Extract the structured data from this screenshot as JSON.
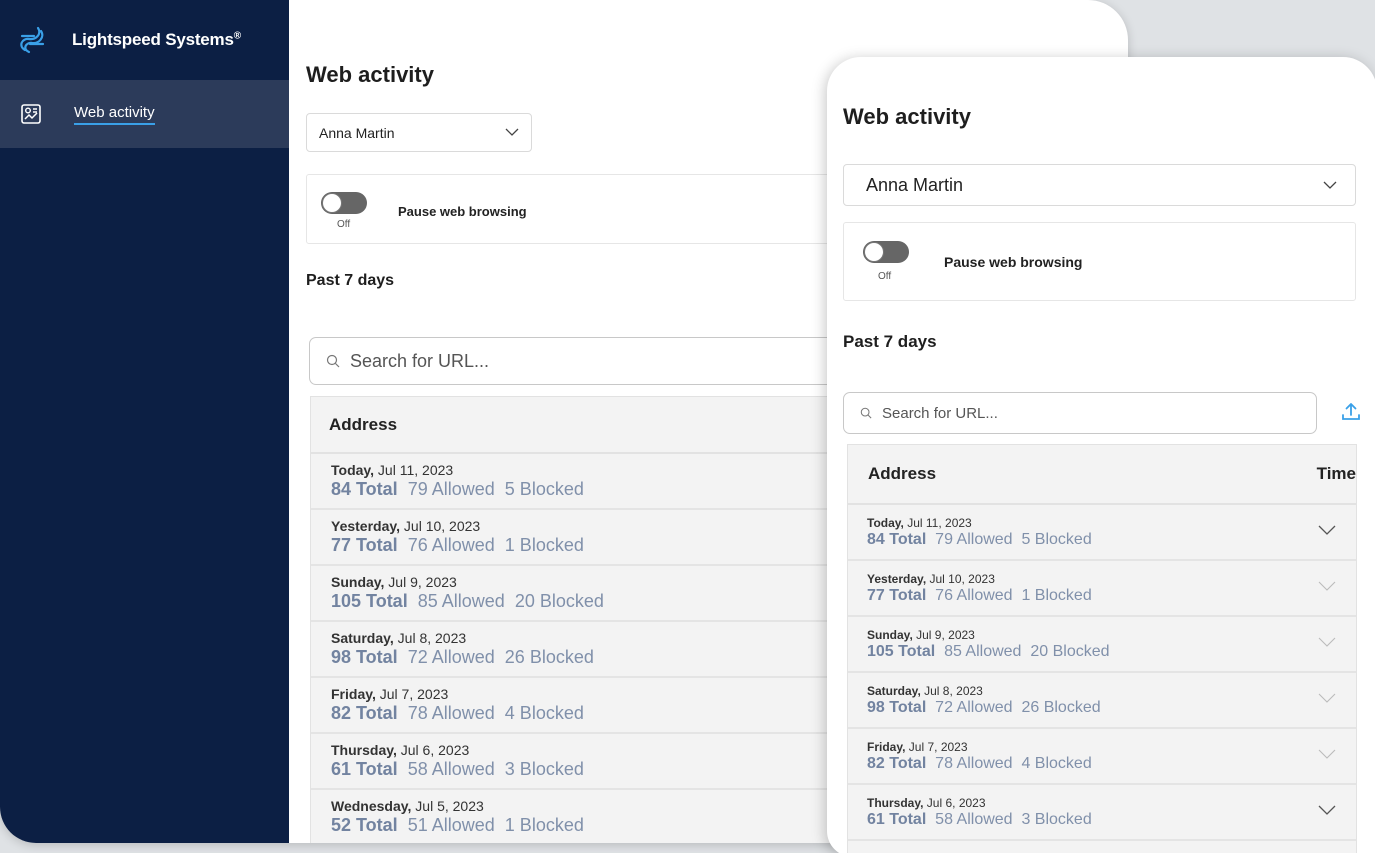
{
  "app": {
    "brand": "Lightspeed Systems",
    "brand_mark": "®"
  },
  "sidebar": {
    "items": [
      {
        "label": "Web activity",
        "icon": "activity-chart-icon"
      }
    ]
  },
  "page": {
    "title": "Web activity",
    "student_select": "Anna Martin",
    "pause": {
      "label": "Pause web browsing",
      "state": "Off"
    },
    "period": "Past 7 days",
    "search_placeholder": "Search for URL...",
    "table": {
      "columns": [
        "Address",
        "Time"
      ],
      "rows": [
        {
          "day": "Today,",
          "date": " Jul 11, 2023",
          "total": "84 Total",
          "allowed": "79 Allowed",
          "blocked": "5 Blocked"
        },
        {
          "day": "Yesterday,",
          "date": " Jul 10, 2023",
          "total": "77 Total",
          "allowed": "76 Allowed",
          "blocked": "1 Blocked"
        },
        {
          "day": "Sunday,",
          "date": " Jul 9, 2023",
          "total": "105 Total",
          "allowed": "85 Allowed",
          "blocked": "20 Blocked"
        },
        {
          "day": "Saturday,",
          "date": " Jul 8, 2023",
          "total": "98 Total",
          "allowed": "72 Allowed",
          "blocked": "26 Blocked"
        },
        {
          "day": "Friday,",
          "date": " Jul 7, 2023",
          "total": "82 Total",
          "allowed": "78 Allowed",
          "blocked": "4 Blocked"
        },
        {
          "day": "Thursday,",
          "date": " Jul 6, 2023",
          "total": "61 Total",
          "allowed": "58 Allowed",
          "blocked": "3 Blocked"
        },
        {
          "day": "Wednesday,",
          "date": " Jul 5, 2023",
          "total": "52 Total",
          "allowed": "51 Allowed",
          "blocked": "1 Blocked"
        }
      ]
    }
  },
  "colors": {
    "sidebar": "#0c1f44",
    "sidebar_active": "#2c3b5a",
    "accent": "#3aa0e8",
    "stats_text": "#8090aa"
  }
}
